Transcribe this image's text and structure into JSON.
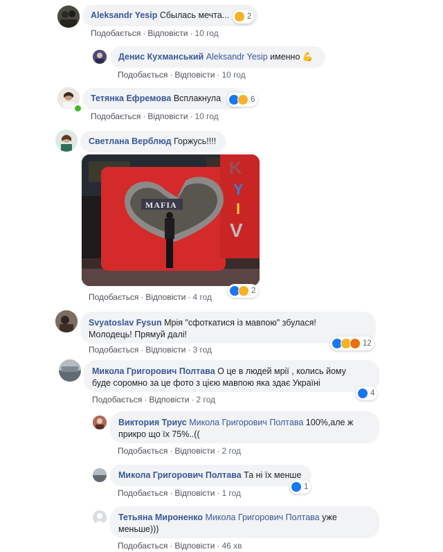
{
  "actions": {
    "like": "Подобається",
    "reply": "Відповісти",
    "sep": "·"
  },
  "comments": [
    {
      "author": "Aleksandr Yesip",
      "text": "Сбылась мечта...",
      "time": "10 год",
      "reactions": "2"
    },
    {
      "author": "Денис Кухманський",
      "mention": "Aleksandr Yesip",
      "text": "именно",
      "emoji": "💪",
      "time": "10 год"
    },
    {
      "author": "Тетянка Ефремова",
      "text": "Всплакнула",
      "time": "10 год",
      "reactions": "6"
    },
    {
      "author": "Светлана Верблюд",
      "text": "Горжусь!!!!",
      "time": "4 год",
      "reactions": "2",
      "photo": {
        "sign": "MAFIA",
        "letters": [
          "K",
          "Y",
          "I",
          "V"
        ]
      }
    },
    {
      "author": "Svyatoslav Fysun",
      "text_line1": "Мрія \"сфоткатися із мавпою\" збулася!",
      "text_line2": "Молодець! Прямуй далі!",
      "time": "3 год",
      "reactions": "12"
    },
    {
      "author": "Микола Григорович Полтава",
      "text_line1": "О це в людей мрії , колись йому",
      "text_line2": "буде соромно за це фото з цією мавпою яка здає Україні",
      "time": "2 год",
      "reactions": "4"
    },
    {
      "author": "Виктория Триус",
      "mention": "Микола Григорович Полтава",
      "text_line1": "100%,але ж",
      "text_line2": "прикро що їх 75%..((",
      "time": "2 год"
    },
    {
      "author": "Микола Григорович Полтава",
      "text": "Та ні їх менше",
      "time": "1 год",
      "reactions": "1"
    },
    {
      "author": "Тетьяна Мироненко",
      "mention": "Микола Григорович Полтава",
      "text_line1": "уже",
      "text_line2": "меньше)))",
      "time": "46 хв"
    }
  ]
}
